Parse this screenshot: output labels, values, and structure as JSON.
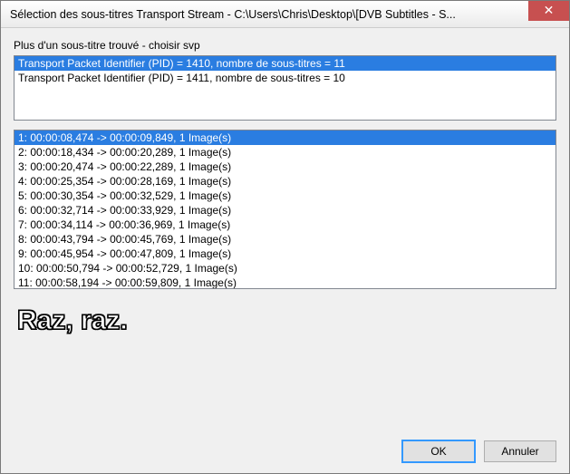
{
  "window": {
    "title": "Sélection des sous-titres Transport Stream - C:\\Users\\Chris\\Desktop\\[DVB Subtitles - S..."
  },
  "label": {
    "pick": "Plus d'un sous-titre trouvé - choisir svp"
  },
  "pidList": {
    "items": [
      "Transport Packet Identifier (PID) = 1410, nombre de sous-titres = 11",
      "Transport Packet Identifier (PID) = 1411, nombre de sous-titres = 10"
    ],
    "selectedIndex": 0
  },
  "subList": {
    "items": [
      "1: 00:00:08,474 -> 00:00:09,849, 1 Image(s)",
      "2: 00:00:18,434 -> 00:00:20,289, 1 Image(s)",
      "3: 00:00:20,474 -> 00:00:22,289, 1 Image(s)",
      "4: 00:00:25,354 -> 00:00:28,169, 1 Image(s)",
      "5: 00:00:30,354 -> 00:00:32,529, 1 Image(s)",
      "6: 00:00:32,714 -> 00:00:33,929, 1 Image(s)",
      "7: 00:00:34,114 -> 00:00:36,969, 1 Image(s)",
      "8: 00:00:43,794 -> 00:00:45,769, 1 Image(s)",
      "9: 00:00:45,954 -> 00:00:47,809, 1 Image(s)",
      "10: 00:00:50,794 -> 00:00:52,729, 1 Image(s)",
      "11: 00:00:58,194 -> 00:00:59,809, 1 Image(s)"
    ],
    "selectedIndex": 0
  },
  "preview": {
    "text": "Raz, raz."
  },
  "buttons": {
    "ok": "OK",
    "cancel": "Annuler"
  },
  "icons": {
    "close": "✕"
  }
}
